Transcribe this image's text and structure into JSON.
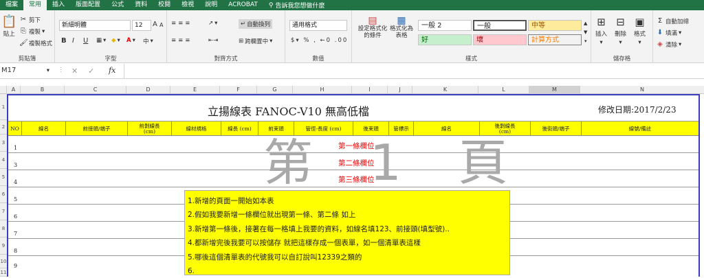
{
  "tabs": [
    "檔案",
    "常用",
    "插入",
    "版面配置",
    "公式",
    "資料",
    "校閱",
    "檢視",
    "說明",
    "ACROBAT"
  ],
  "tell_me": "告訴我您想做什麼",
  "clipboard": {
    "paste": "貼上",
    "cut": "剪下",
    "copy": "複製",
    "format_painter": "複製格式",
    "label": "剪貼簿"
  },
  "font": {
    "name": "新細明體",
    "size": "12",
    "grow": "A",
    "shrink": "A",
    "bold": "B",
    "italic": "I",
    "underline": "U",
    "label": "字型",
    "zhu_yin": "中"
  },
  "alignment": {
    "wrap": "自動換列",
    "merge": "跨欄置中",
    "label": "對齊方式"
  },
  "number": {
    "format": "通用格式",
    "label": "數值"
  },
  "styles": {
    "conditional": "設定格式化的條件",
    "format_table": "格式化為表格",
    "label": "樣式",
    "cells": [
      {
        "text": "一般 2"
      },
      {
        "text": "一般"
      },
      {
        "text": "中等"
      },
      {
        "text": "好"
      },
      {
        "text": "壞"
      },
      {
        "text": "計算方式"
      }
    ]
  },
  "cells_group": {
    "insert": "插入",
    "delete": "刪除",
    "format": "格式",
    "label": "儲存格"
  },
  "editing": {
    "autosum": "自動加總",
    "fill": "填滿",
    "clear": "清除"
  },
  "name_box": "M17",
  "fx": "fx",
  "columns": [
    "A",
    "B",
    "C",
    "D",
    "E",
    "F",
    "G",
    "H",
    "I",
    "J",
    "K",
    "L",
    "M",
    "N"
  ],
  "sheet": {
    "title": "立揚線表 FANOC-V10 無高低檔",
    "revised": "修改日期:2017/2/23",
    "headers": [
      "NO",
      "線名",
      "前接頭/端子",
      "前剝線長\n(cm)",
      "線材規格",
      "線長 (cm)",
      "前束頭",
      "管徑-長度 (cm)",
      "後束頭",
      "管標示",
      "線名",
      "後剝線長\n(cm)",
      "後街頭/端子",
      "線號/備註"
    ],
    "row_numbers": [
      "1",
      "3",
      "4",
      "5",
      "6",
      "7",
      "8",
      "9"
    ],
    "red_labels": [
      "第一條欄位",
      "第二條欄位",
      "第三條欄位"
    ],
    "watermark": "第 1 頁"
  },
  "row_headers": [
    "1",
    "2",
    "3",
    "4",
    "5",
    "6",
    "7",
    "8",
    "9",
    "10",
    "11"
  ],
  "note": [
    "1.新增的頁面一開始如本表",
    "2.假如我要新增一條欄位就出現第一條、第二條 如上",
    "3.新增第一條後，接著在每一格填上我要的資料，如線名填123、前接頭(填型號)..",
    "4.都新增完後我要可以按儲存 就把這樣存成一個表單，如一個清單表這樣",
    "5.哪後這個清單表的代號我可以自訂說叫12339之類的",
    "6."
  ]
}
